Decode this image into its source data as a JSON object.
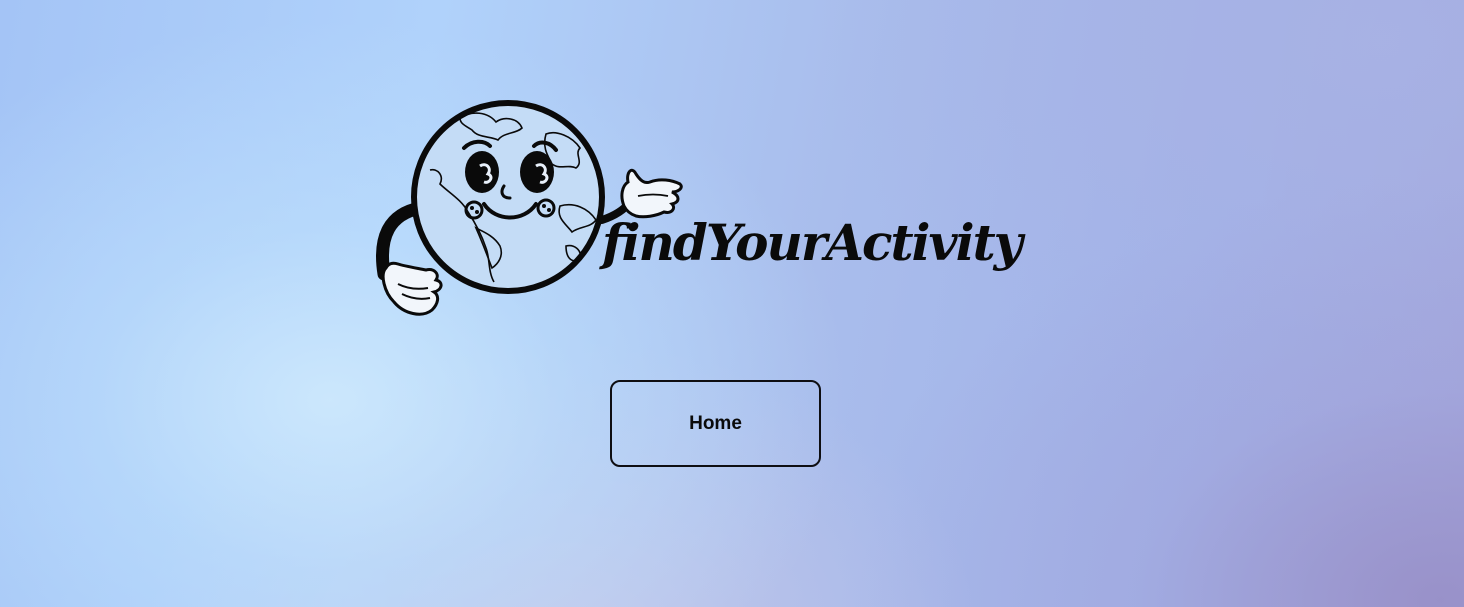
{
  "brand": {
    "name": "findYourActivity",
    "logo_icon": "globe-mascot-icon"
  },
  "nav": {
    "home_label": "Home"
  },
  "colors": {
    "text": "#0a0a0a",
    "button_border": "#0e0e12",
    "background_light": "#c8e4fb",
    "background_purple": "#9a96cc"
  }
}
